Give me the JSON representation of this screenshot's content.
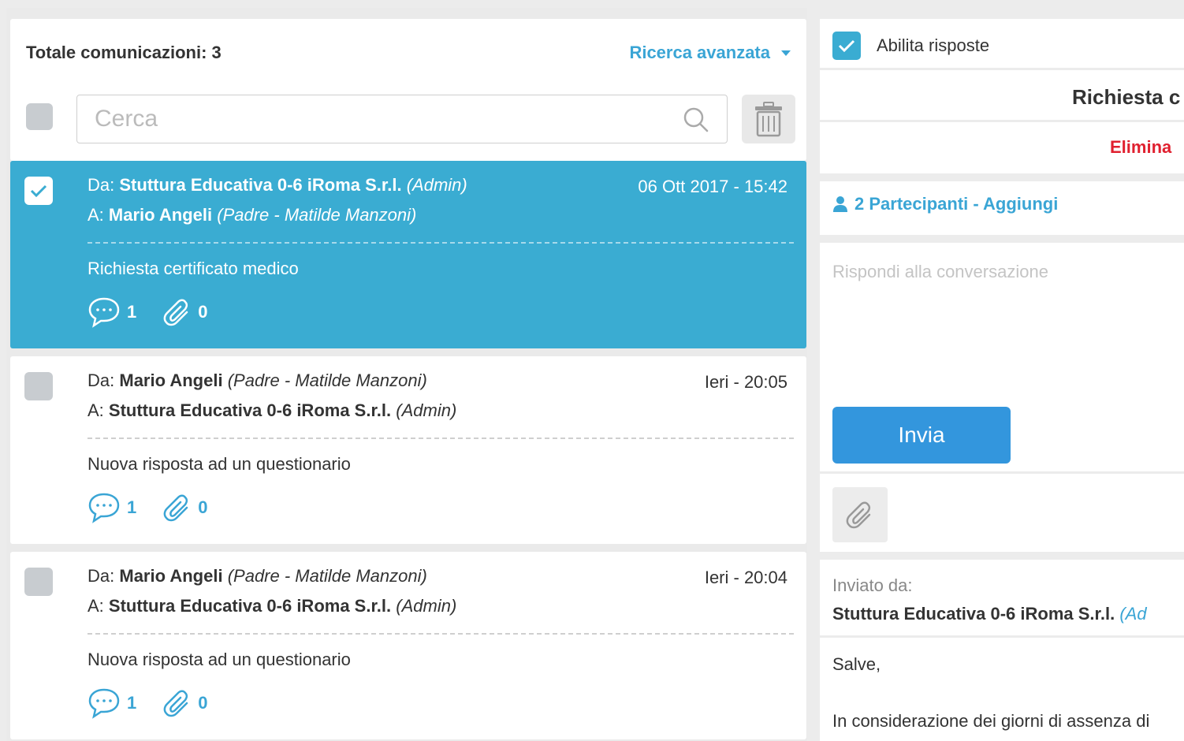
{
  "list": {
    "total_label": "Totale comunicazioni: 3",
    "advanced_search": "Ricerca avanzata",
    "search_placeholder": "Cerca"
  },
  "messages": [
    {
      "from_prefix": "Da:",
      "from_name": "Stuttura Educativa 0-6 iRoma S.r.l.",
      "from_role": "(Admin)",
      "to_prefix": "A:",
      "to_name": "Mario Angeli",
      "to_role": "(Padre - Matilde Manzoni)",
      "date": "06 Ott 2017 - 15:42",
      "subject": "Richiesta certificato medico",
      "comments": "1",
      "attachments": "0"
    },
    {
      "from_prefix": "Da:",
      "from_name": "Mario Angeli",
      "from_role": "(Padre - Matilde Manzoni)",
      "to_prefix": "A:",
      "to_name": "Stuttura Educativa 0-6 iRoma S.r.l.",
      "to_role": "(Admin)",
      "date": "Ieri - 20:05",
      "subject": "Nuova risposta ad un questionario",
      "comments": "1",
      "attachments": "0"
    },
    {
      "from_prefix": "Da:",
      "from_name": "Mario Angeli",
      "from_role": "(Padre - Matilde Manzoni)",
      "to_prefix": "A:",
      "to_name": "Stuttura Educativa 0-6 iRoma S.r.l.",
      "to_role": "(Admin)",
      "date": "Ieri - 20:04",
      "subject": "Nuova risposta ad un questionario",
      "comments": "1",
      "attachments": "0"
    }
  ],
  "detail": {
    "enable_replies": "Abilita risposte",
    "title": "Richiesta c",
    "delete": "Elimina",
    "participants": "2 Partecipanti - Aggiungi",
    "reply_placeholder": "Rispondi alla conversazione",
    "send": "Invia",
    "sent_by_label": "Inviato da:",
    "sender_name": "Stuttura Educativa 0-6 iRoma S.r.l.",
    "sender_role": "(Ad",
    "body_greeting": "Salve,",
    "body_line": "In considerazione dei giorni di assenza di"
  },
  "colors": {
    "accent": "#3aacd2",
    "link": "#3aa5d5",
    "button": "#3396dd",
    "danger": "#e0202f"
  }
}
